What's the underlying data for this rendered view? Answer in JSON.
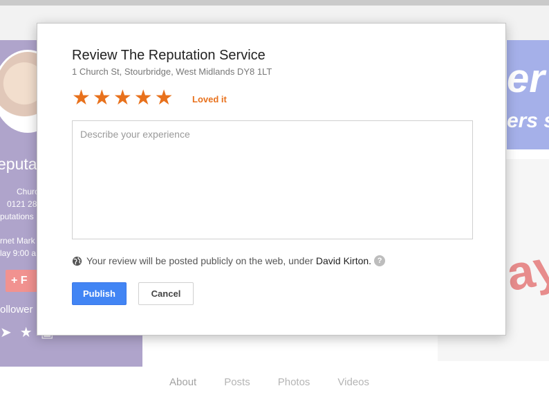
{
  "background": {
    "profile_title": "eputat",
    "address_fragment": "Church St",
    "phone_fragment": "0121 28",
    "website_fragment": "putations",
    "hours_fragment_1": "rnet Mark",
    "hours_fragment_2": "lay 9:00 a",
    "follow_fragment": "F",
    "followers_fragment": "ollower",
    "ad_big_text": "er",
    "ad_small_text": "ers s",
    "ad_paper_text": "ay",
    "tabs": [
      "About",
      "Posts",
      "Photos",
      "Videos"
    ]
  },
  "dialog": {
    "title": "Review The Reputation Service",
    "address": "1 Church St, Stourbridge, West Midlands DY8 1LT",
    "rating": 5,
    "rating_max": 5,
    "rating_label": "Loved it",
    "review_placeholder": "Describe your experience",
    "notice_text": "Your review will be posted publicly on the web, under",
    "notice_user": "David Kirton.",
    "help_symbol": "?",
    "publish_label": "Publish",
    "cancel_label": "Cancel"
  },
  "colors": {
    "star": "#e8711c",
    "publish_button": "#4285f4",
    "profile_card": "#6d5aa0",
    "follow_button": "#e53935"
  },
  "icons": [
    "globe-icon",
    "help-icon",
    "star-icon"
  ]
}
